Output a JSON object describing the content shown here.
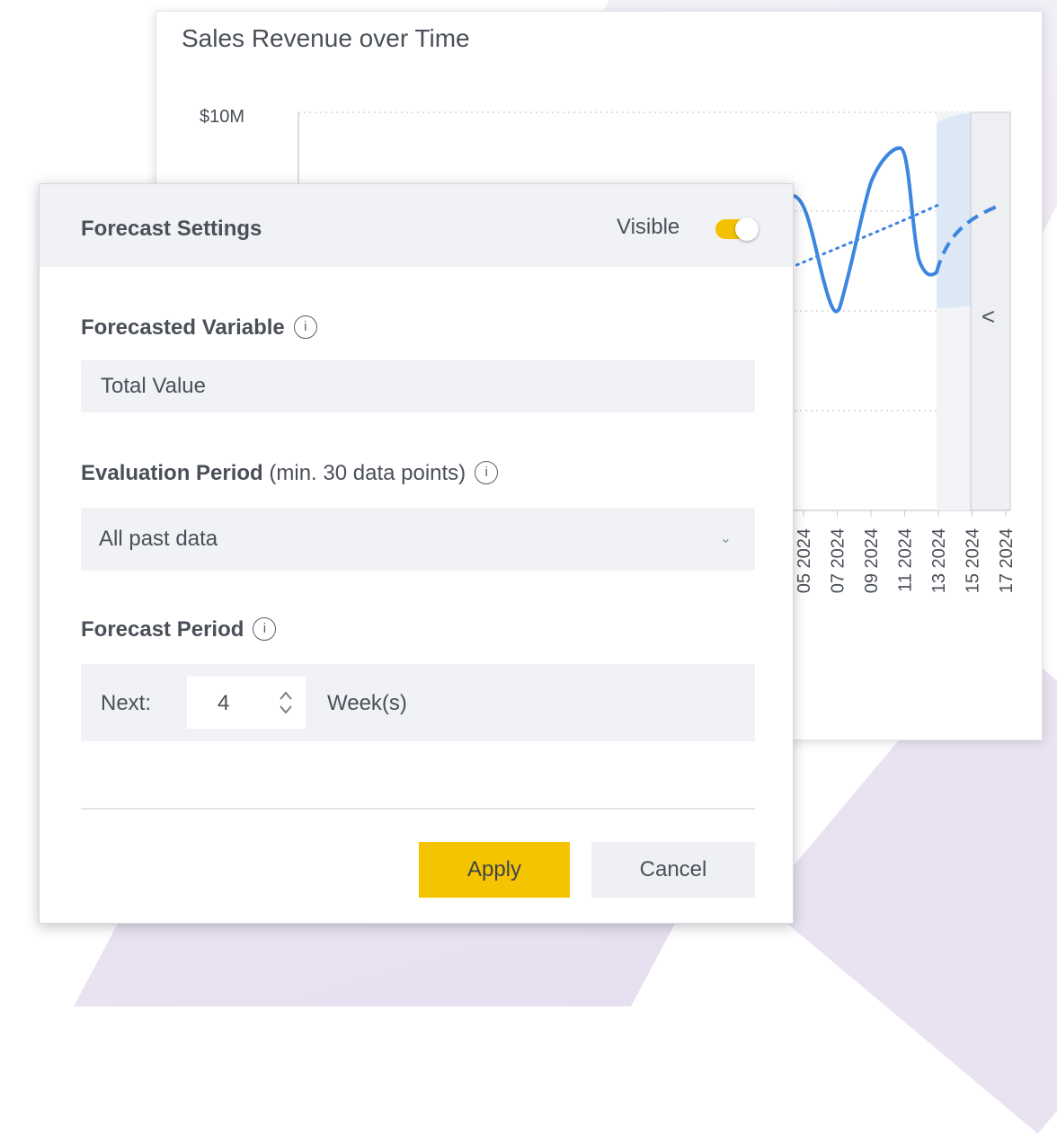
{
  "chart": {
    "title": "Sales Revenue over Time",
    "y_axis_top_label": "$10M",
    "x_tick_labels": [
      "05 2024",
      "07 2024",
      "09 2024",
      "11 2024",
      "13 2024",
      "15 2024",
      "17 2024"
    ],
    "colors": {
      "series": "#3d86e0",
      "forecast_band": "#dde8f6",
      "grid": "#c9cbd1"
    },
    "collapse_icon": "chevron-left-icon"
  },
  "panel": {
    "title": "Forecast Settings",
    "visible_label": "Visible",
    "visible_on": true,
    "forecasted_variable": {
      "label": "Forecasted Variable",
      "value": "Total Value"
    },
    "evaluation_period": {
      "label": "Evaluation Period",
      "hint": "(min. 30 data points)",
      "selected": "All past data"
    },
    "forecast_period": {
      "label": "Forecast Period",
      "prefix": "Next:",
      "value": "4",
      "unit": "Week(s)"
    },
    "apply_label": "Apply",
    "cancel_label": "Cancel",
    "info_glyph": "i",
    "colors": {
      "accent": "#f5c400",
      "field_bg": "#f1f2f5"
    }
  }
}
